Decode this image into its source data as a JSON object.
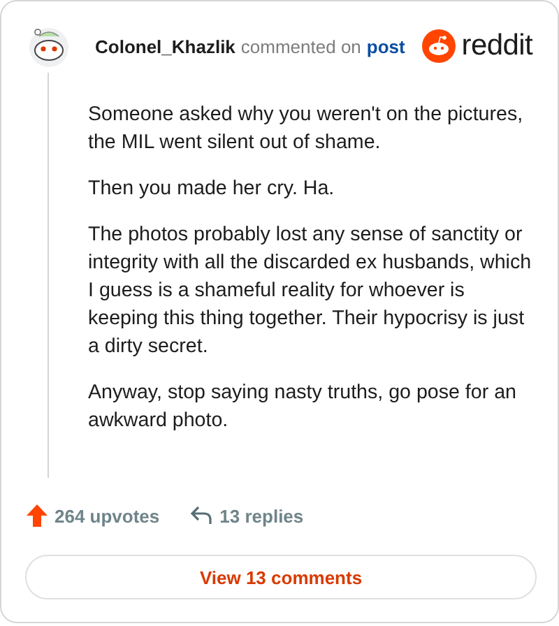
{
  "header": {
    "author": "Colonel_Khazlik",
    "action": "commented on",
    "link": "post",
    "brand": "reddit"
  },
  "paragraphs": [
    "Someone asked why you weren't on the pictures, the MIL went silent out of shame.",
    "Then you made her cry. Ha.",
    "The photos probably lost any sense of sanctity or integrity with all the discarded ex husbands, which I guess is a shameful reality for whoever is keeping this thing together. Their hypocrisy is just a dirty secret.",
    "Anyway, stop saying nasty truths, go pose for an awkward photo."
  ],
  "stats": {
    "upvotes": "264 upvotes",
    "replies": "13 replies"
  },
  "button": "View 13 comments"
}
